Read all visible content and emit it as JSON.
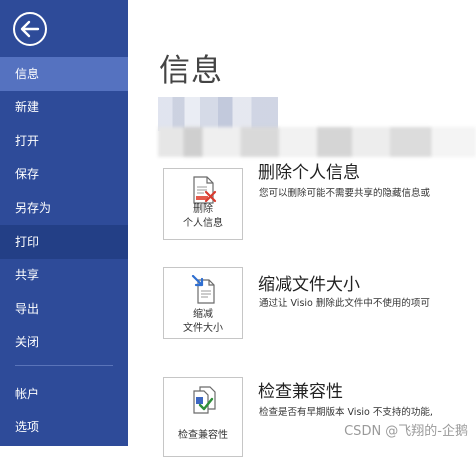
{
  "sidebar": {
    "items": [
      {
        "label": "信息"
      },
      {
        "label": "新建"
      },
      {
        "label": "打开"
      },
      {
        "label": "保存"
      },
      {
        "label": "另存为"
      },
      {
        "label": "打印"
      },
      {
        "label": "共享"
      },
      {
        "label": "导出"
      },
      {
        "label": "关闭"
      },
      {
        "label": "帐户"
      },
      {
        "label": "选项"
      }
    ]
  },
  "main": {
    "title": "信息",
    "sections": [
      {
        "tile_label_line1": "删除",
        "tile_label_line2": "个人信息",
        "title": "删除个人信息",
        "description": "您可以删除可能不需要共享的隐藏信息或"
      },
      {
        "tile_label_line1": "缩减",
        "tile_label_line2": "文件大小",
        "title": "缩减文件大小",
        "description": "通过让 Visio 删除此文件中不使用的项可"
      },
      {
        "tile_label_line1": "检查兼容性",
        "title": "检查兼容性",
        "description": "检查是否有早期版本 Visio 不支持的功能,"
      }
    ]
  },
  "watermark": "CSDN @飞翔的-企鹅",
  "colors": {
    "sidebar_bg": "#2e4b99",
    "sidebar_active": "#5572c0",
    "accent_red": "#d83b2f"
  }
}
